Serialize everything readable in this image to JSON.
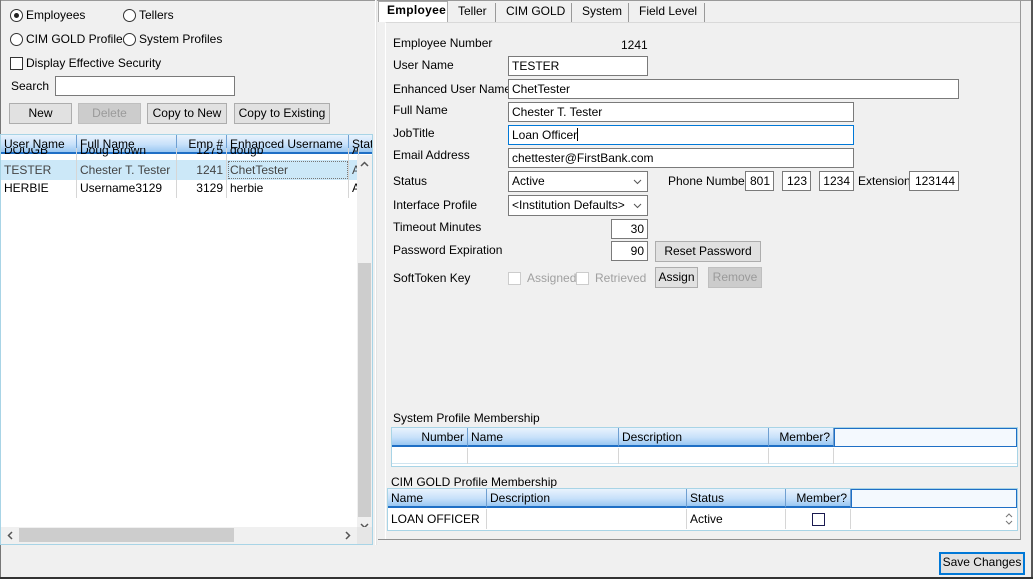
{
  "filter": {
    "employees_label": "Employees",
    "tellers_label": "Tellers",
    "cim_gold_profiles_label": "CIM GOLD Profiles",
    "system_profiles_label": "System Profiles",
    "selected": "Employees",
    "display_effective_security_label": "Display Effective Security",
    "display_effective_security_checked": false,
    "search_label": "Search",
    "search_value": ""
  },
  "actions": {
    "new_label": "New",
    "delete_label": "Delete",
    "copy_to_new_label": "Copy to New",
    "copy_to_existing_label": "Copy to Existing"
  },
  "user_grid": {
    "columns": [
      "User Name",
      "Full Name",
      "Emp #",
      "Enhanced Username",
      "Stat"
    ],
    "rows": [
      {
        "user_name": "DOUGB",
        "full_name": "Doug Brown",
        "emp": "1275",
        "enhanced": "dougb",
        "status": "A"
      },
      {
        "user_name": "TESTER",
        "full_name": "Chester T. Tester",
        "emp": "1241",
        "enhanced": "ChetTester",
        "status": "A",
        "selected": true
      },
      {
        "user_name": "HERBIE",
        "full_name": "Username3129",
        "emp": "3129",
        "enhanced": "herbie",
        "status": "A"
      }
    ]
  },
  "tabs": [
    {
      "label": "Employee",
      "active": true
    },
    {
      "label": "Teller"
    },
    {
      "label": "CIM GOLD"
    },
    {
      "label": "System"
    },
    {
      "label": "Field Level"
    }
  ],
  "employee": {
    "employee_number_label": "Employee Number",
    "employee_number": "1241",
    "user_name_label": "User Name",
    "user_name": "TESTER",
    "enhanced_user_name_label": "Enhanced User Name",
    "enhanced_user_name": "ChetTester",
    "full_name_label": "Full Name",
    "full_name": "Chester T. Tester",
    "job_title_label": "JobTitle",
    "job_title": "Loan Officer",
    "email_label": "Email Address",
    "email": "chettester@FirstBank.com",
    "status_label": "Status",
    "status": "Active",
    "phone_label": "Phone Number",
    "phone_area": "801",
    "phone_prefix": "123",
    "phone_line": "1234",
    "extension_label": "Extension",
    "extension": "123144",
    "interface_profile_label": "Interface Profile",
    "interface_profile": "<Institution Defaults>",
    "timeout_label": "Timeout Minutes",
    "timeout": "30",
    "password_expiration_label": "Password Expiration",
    "password_expiration": "90",
    "reset_password_label": "Reset Password",
    "softtoken_label": "SoftToken Key",
    "assigned_label": "Assigned",
    "retrieved_label": "Retrieved",
    "assign_label": "Assign",
    "remove_label": "Remove"
  },
  "system_profile_membership": {
    "title": "System Profile Membership",
    "columns": [
      "Number",
      "Name",
      "Description",
      "Member?"
    ],
    "rows": []
  },
  "cim_gold_profile_membership": {
    "title": "CIM GOLD Profile Membership",
    "columns": [
      "Name",
      "Description",
      "Status",
      "Member?"
    ],
    "rows": [
      {
        "name": "LOAN OFFICER",
        "description": "",
        "status": "Active",
        "member": false
      }
    ]
  },
  "footer": {
    "save_changes_label": "Save Changes"
  }
}
